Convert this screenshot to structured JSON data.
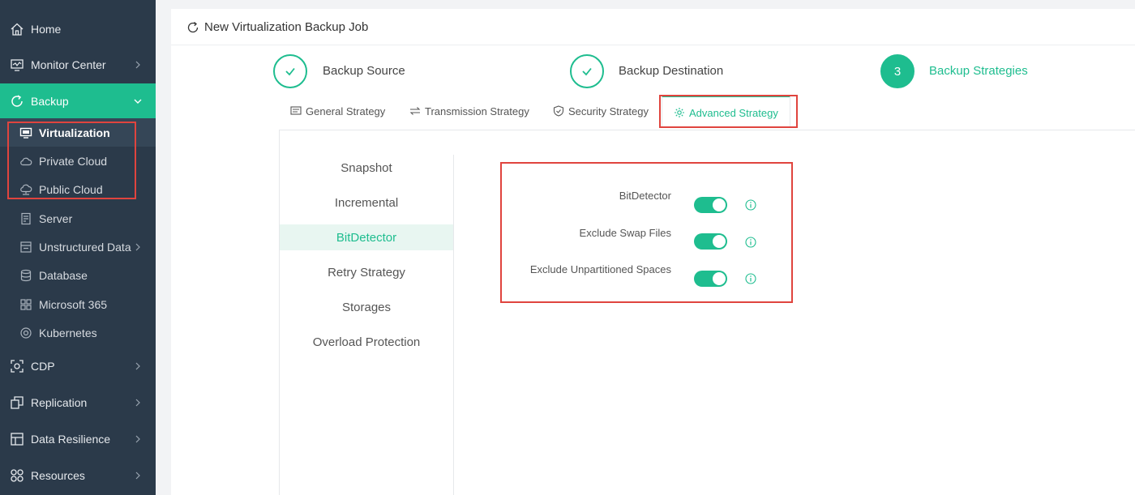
{
  "sidebar": {
    "items": [
      {
        "label": "Home",
        "icon": "home-icon"
      },
      {
        "label": "Monitor Center",
        "icon": "monitor-icon"
      },
      {
        "label": "Backup",
        "icon": "backup-icon"
      },
      {
        "label": "CDP",
        "icon": "cdp-icon"
      },
      {
        "label": "Replication",
        "icon": "replication-icon"
      },
      {
        "label": "Data Resilience",
        "icon": "data-resilience-icon"
      },
      {
        "label": "Resources",
        "icon": "resources-icon"
      }
    ],
    "backup_sub": [
      {
        "label": "Virtualization",
        "icon": "virtualization-icon"
      },
      {
        "label": "Private Cloud",
        "icon": "private-cloud-icon"
      },
      {
        "label": "Public Cloud",
        "icon": "public-cloud-icon"
      },
      {
        "label": "Server",
        "icon": "server-icon"
      },
      {
        "label": "Unstructured Data",
        "icon": "unstructured-data-icon"
      },
      {
        "label": "Database",
        "icon": "database-icon"
      },
      {
        "label": "Microsoft 365",
        "icon": "microsoft-365-icon"
      },
      {
        "label": "Kubernetes",
        "icon": "kubernetes-icon"
      }
    ]
  },
  "header": {
    "title": "New Virtualization Backup Job",
    "icon": "refresh-icon"
  },
  "steps": [
    {
      "label": "Backup Source",
      "status": "done"
    },
    {
      "label": "Backup Destination",
      "status": "done"
    },
    {
      "number": "3",
      "label": "Backup Strategies",
      "status": "current"
    }
  ],
  "tabs": [
    {
      "label": "General Strategy",
      "icon": "list-icon"
    },
    {
      "label": "Transmission Strategy",
      "icon": "transfer-icon"
    },
    {
      "label": "Security Strategy",
      "icon": "shield-icon"
    },
    {
      "label": "Advanced Strategy",
      "icon": "gear-icon"
    }
  ],
  "submenu": [
    "Snapshot",
    "Incremental",
    "BitDetector",
    "Retry Strategy",
    "Storages",
    "Overload Protection"
  ],
  "options": [
    {
      "label": "BitDetector",
      "enabled": true
    },
    {
      "label": "Exclude Swap Files",
      "enabled": true
    },
    {
      "label": "Exclude Unpartitioned Spaces",
      "enabled": true
    }
  ],
  "colors": {
    "accent": "#1ebd8f",
    "sidebar_bg": "#2b3a4a",
    "highlight_box": "#e0443e"
  }
}
